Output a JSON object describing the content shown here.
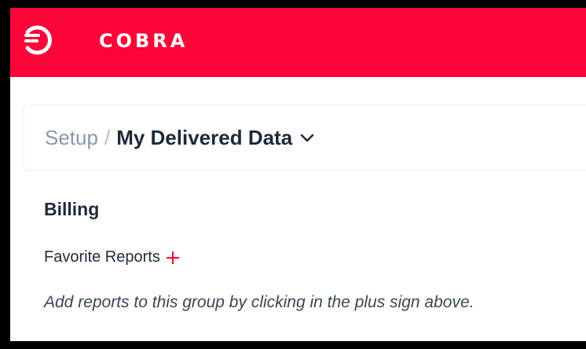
{
  "header": {
    "brand": "COBRA",
    "logo_icon": "cobra-logo-icon",
    "background_color": "#fc0538"
  },
  "breadcrumb": {
    "parent": "Setup",
    "separator": "/",
    "current": "My Delivered Data",
    "dropdown_icon": "chevron-down-icon"
  },
  "section": {
    "title": "Billing",
    "group_label": "Favorite Reports",
    "add_icon": "plus-icon",
    "add_icon_color": "#fc0538",
    "empty_hint": "Add reports to this group by clicking in the plus sign above."
  }
}
